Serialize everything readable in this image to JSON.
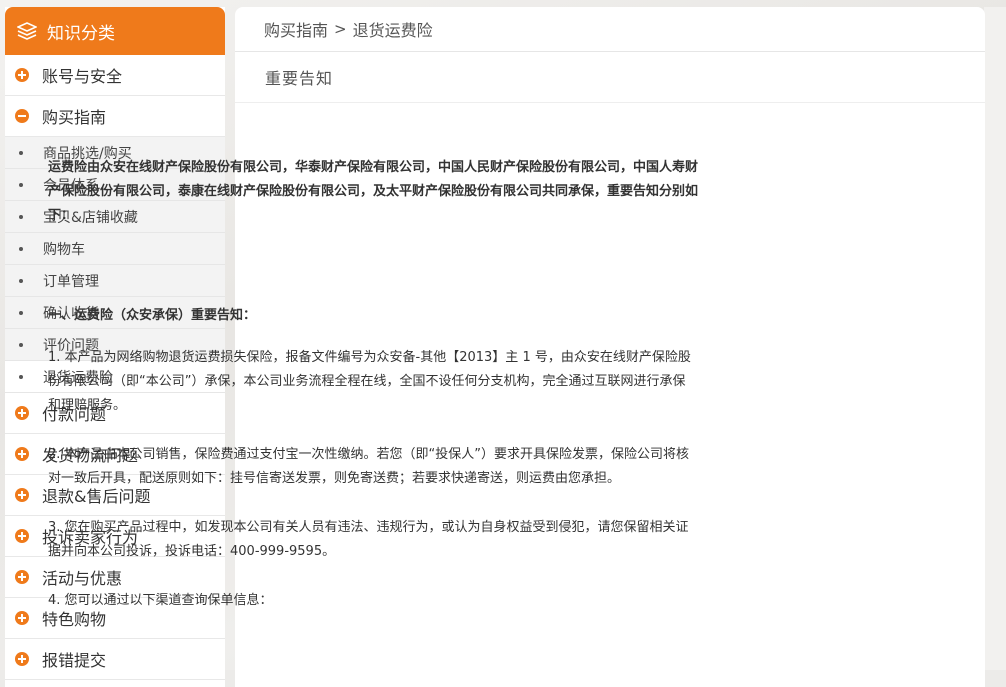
{
  "sidebar": {
    "title": "知识分类",
    "categories_top": [
      {
        "label": "账号与安全",
        "expanded": false
      },
      {
        "label": "购买指南",
        "expanded": true
      }
    ],
    "sub_items": [
      "商品挑选/购买",
      "会员体系",
      "宝贝&店铺收藏",
      "购物车",
      "订单管理",
      "确认收货",
      "评价问题",
      "退货运费险"
    ],
    "active_sub": "退货运费险",
    "categories_bottom": [
      "付款问题",
      "发货物流问题",
      "退款&售后问题",
      "投诉卖家行为",
      "活动与优惠",
      "特色购物",
      "报错提交"
    ]
  },
  "breadcrumb": {
    "parent": "购买指南",
    "separator": ">",
    "current": "退货运费险"
  },
  "section_title": "重要告知",
  "article": {
    "intro": "运费险由众安在线财产保险股份有限公司，华泰财产保险有限公司，中国人民财产保险股份有限公司，中国人寿财产保险股份有限公司，泰康在线财产保险股份有限公司，及太平财产保险股份有限公司共同承保，重要告知分别如下：",
    "heading1": "一、运费险（众安承保）重要告知：",
    "p1": "1. 本产品为网络购物退货运费损失保险，报备文件编号为众安备-其他【2013】主 1 号，由众安在线财产保险股份有限公司（即“本公司”）承保，本公司业务流程全程在线，全国不设任何分支机构，完全通过互联网进行承保和理赔服务。",
    "p2": "2. 本产品由本公司销售，保险费通过支付宝一次性缴纳。若您（即“投保人”）要求开具保险发票，保险公司将核对一致后开具，配送原则如下：挂号信寄送发票，则免寄送费；若要求快递寄送，则运费由您承担。",
    "p3": "3. 您在购买产品过程中，如发现本公司有关人员有违法、违规行为，或认为自身权益受到侵犯，请您保留相关证据并向本公司投诉，投诉电话：400-999-9595。",
    "p4": "4. 您可以通过以下渠道查询保单信息："
  },
  "colors": {
    "accent": "#ef7a1b"
  }
}
